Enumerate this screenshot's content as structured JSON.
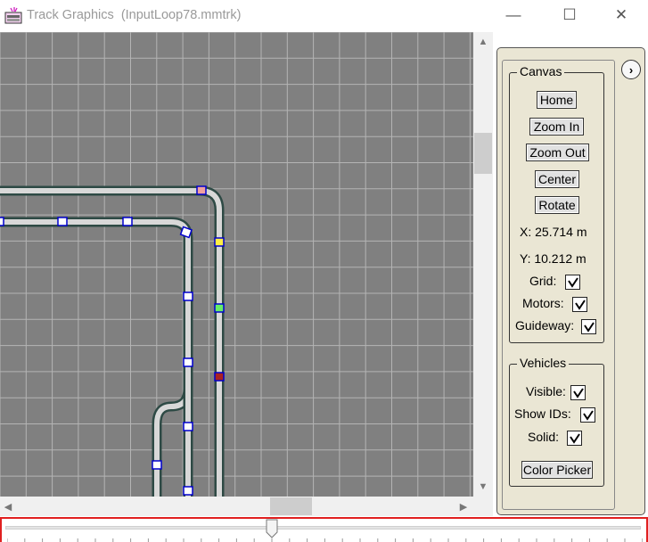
{
  "window": {
    "title": "Track Graphics  (InputLoop78.mmtrk)",
    "minimize_glyph": "—",
    "maximize_glyph": "☐",
    "close_glyph": "✕"
  },
  "canvas_panel": {
    "legend": "Canvas",
    "home_label": "Home",
    "zoom_in_label": "Zoom In",
    "zoom_out_label": "Zoom Out",
    "center_label": "Center",
    "rotate_label": "Rotate",
    "x_readout": "X:  25.714  m",
    "y_readout": "Y:  10.212  m",
    "grid_label": "Grid:",
    "grid_checked": true,
    "motors_label": "Motors:",
    "motors_checked": true,
    "guideway_label": "Guideway:",
    "guideway_checked": true
  },
  "vehicles_panel": {
    "legend": "Vehicles",
    "visible_label": "Visible:",
    "visible_checked": true,
    "show_ids_label": "Show IDs:",
    "show_ids_checked": true,
    "solid_label": "Solid:",
    "solid_checked": true,
    "color_picker_label": "Color Picker"
  },
  "expand_glyph": "›",
  "scrollbar": {
    "up": "▲",
    "down": "▼",
    "left": "◀",
    "right": "▶"
  },
  "timeline": {
    "position_fraction": 0.42
  },
  "colors": {
    "canvas_bg": "#808080",
    "grid_line": "#b4b4b4",
    "track_rail": "#2e4a45",
    "track_bed": "#d8d8d8",
    "panel_bg": "#eae6d4",
    "slider_border": "#e02020"
  }
}
